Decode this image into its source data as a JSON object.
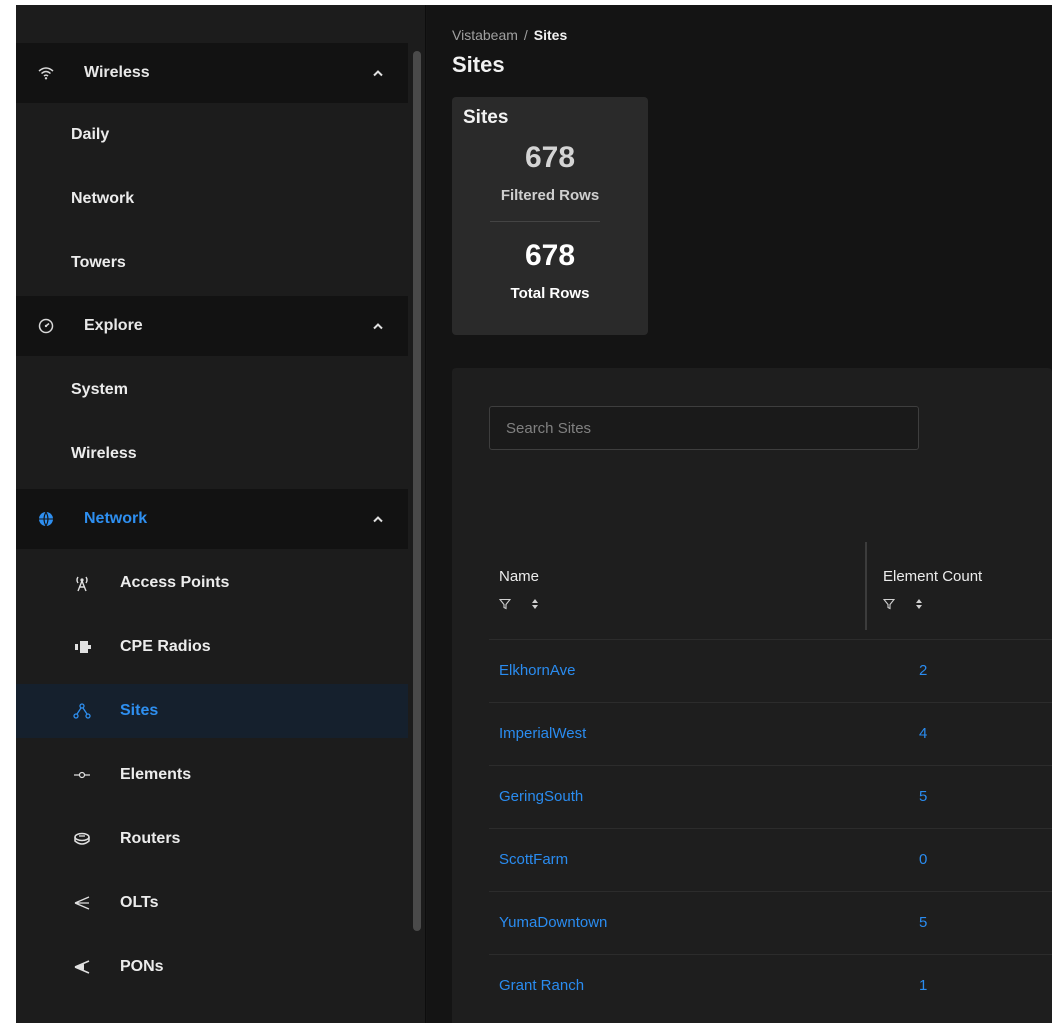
{
  "sidebar": {
    "groups": [
      {
        "label": "Wireless",
        "icon": "wifi-icon",
        "items": [
          {
            "label": "Daily"
          },
          {
            "label": "Network"
          },
          {
            "label": "Towers"
          }
        ]
      },
      {
        "label": "Explore",
        "icon": "gauge-icon",
        "items": [
          {
            "label": "System"
          },
          {
            "label": "Wireless"
          }
        ]
      },
      {
        "label": "Network",
        "icon": "globe-icon",
        "items": [
          {
            "label": "Access Points",
            "icon": "antenna-icon"
          },
          {
            "label": "CPE Radios",
            "icon": "cpe-radio-icon"
          },
          {
            "label": "Sites",
            "icon": "site-tree-icon",
            "active": true
          },
          {
            "label": "Elements",
            "icon": "element-node-icon"
          },
          {
            "label": "Routers",
            "icon": "router-icon"
          },
          {
            "label": "OLTs",
            "icon": "olt-icon"
          },
          {
            "label": "PONs",
            "icon": "pon-icon"
          }
        ]
      }
    ]
  },
  "header": {
    "breadcrumb": {
      "root": "Vistabeam",
      "separator": "/",
      "current": "Sites"
    },
    "title": "Sites"
  },
  "stats": {
    "title": "Sites",
    "filtered_value": "678",
    "filtered_label": "Filtered Rows",
    "total_value": "678",
    "total_label": "Total Rows"
  },
  "search": {
    "placeholder": "Search Sites",
    "value": ""
  },
  "table": {
    "columns": [
      {
        "label": "Name"
      },
      {
        "label": "Element Count"
      }
    ],
    "rows": [
      {
        "name": "ElkhornAve",
        "count": "2"
      },
      {
        "name": "ImperialWest",
        "count": "4"
      },
      {
        "name": "GeringSouth",
        "count": "5"
      },
      {
        "name": "ScottFarm",
        "count": "0"
      },
      {
        "name": "YumaDowntown",
        "count": "5"
      },
      {
        "name": "Grant Ranch",
        "count": "1"
      }
    ]
  },
  "colors": {
    "accent": "#2e8ff0",
    "sidebar_bg": "#1c1c1c",
    "group_header_bg": "#121212",
    "main_bg": "#141414",
    "card_bg": "#2a2a2a",
    "panel_bg": "#1e1e1e"
  }
}
